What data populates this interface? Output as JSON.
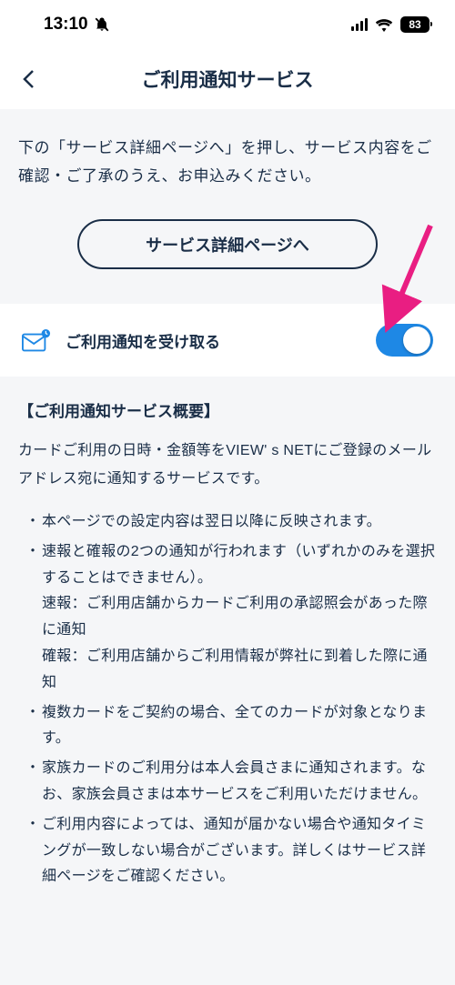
{
  "status": {
    "time": "13:10",
    "battery": "83"
  },
  "header": {
    "title": "ご利用通知サービス"
  },
  "intro": {
    "text": "下の「サービス詳細ページへ」を押し、サービス内容をご確認・ご了承のうえ、お申込みください。",
    "button": "サービス詳細ページへ"
  },
  "toggle": {
    "label": "ご利用通知を受け取る",
    "on": true
  },
  "overview": {
    "title": "【ご利用通知サービス概要】",
    "desc": "カードご利用の日時・金額等をVIEW' s NETにご登録のメールアドレス宛に通知するサービスです。",
    "bullets": [
      "本ページでの設定内容は翌日以降に反映されます。",
      "速報と確報の2つの通知が行われます（いずれかのみを選択することはできません）。\n速報：ご利用店舗からカードご利用の承認照会があった際に通知\n確報：ご利用店舗からご利用情報が弊社に到着した際に通知",
      "複数カードをご契約の場合、全てのカードが対象となります。",
      "家族カードのご利用分は本人会員さまに通知されます。なお、家族会員さまは本サービスをご利用いただけません。",
      "ご利用内容によっては、通知が届かない場合や通知タイミングが一致しない場合がございます。詳しくはサービス詳細ページをご確認ください。"
    ]
  }
}
